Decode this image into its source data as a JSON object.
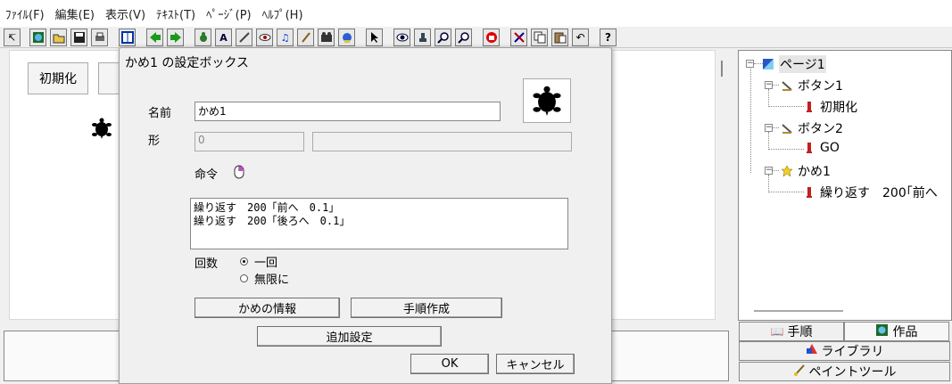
{
  "menu": [
    "ﾌｧｲﾙ(F)",
    "編集(E)",
    "表示(V)",
    "ﾃｷｽﾄ(T)",
    "ﾍﾟｰｼﾞ(P)",
    "ﾍﾙﾌﾟ(H)"
  ],
  "toolbar_icons": [
    "arrow-icon",
    "globe-icon",
    "open-folder-icon",
    "save-icon",
    "print-icon",
    "grid-icon",
    "back-arrow-icon",
    "forward-arrow-icon",
    "turtle-icon",
    "text-icon",
    "pen-icon",
    "eye-icon",
    "music-icon",
    "brush-icon",
    "camera-icon",
    "person-icon",
    "cursor-icon",
    "eye2-icon",
    "stamp-icon",
    "zoom-in-icon",
    "zoom-out-icon",
    "stop-icon",
    "cut-icon",
    "copy-icon",
    "paste-icon",
    "undo-icon",
    "help-icon"
  ],
  "canvas": {
    "init_button": "初期化"
  },
  "tree": {
    "page": "ページ1",
    "button1": "ボタン1",
    "button1_child": "初期化",
    "button2": "ボタン2",
    "button2_child": "GO",
    "turtle": "かめ1",
    "turtle_child": "繰り返す　200｢前へ"
  },
  "tabs": {
    "procedure": "手順",
    "works": "作品",
    "library": "ライブラリ",
    "paint": "ペイントツール"
  },
  "dialog": {
    "title": "かめ1 の設定ボックス",
    "name_label": "名前",
    "name_value": "かめ1",
    "shape_label": "形",
    "shape_value": "0",
    "shape_extra": "",
    "command_label": "命令",
    "commands": "繰り返す　200「前へ　0.1」\n繰り返す　200「後ろへ　0.1」",
    "count_label": "回数",
    "radio_once": "一回",
    "radio_infinite": "無限に",
    "btn_info": "かめの情報",
    "btn_procedure": "手順作成",
    "btn_additional": "追加設定",
    "btn_ok": "OK",
    "btn_cancel": "キャンセル"
  }
}
